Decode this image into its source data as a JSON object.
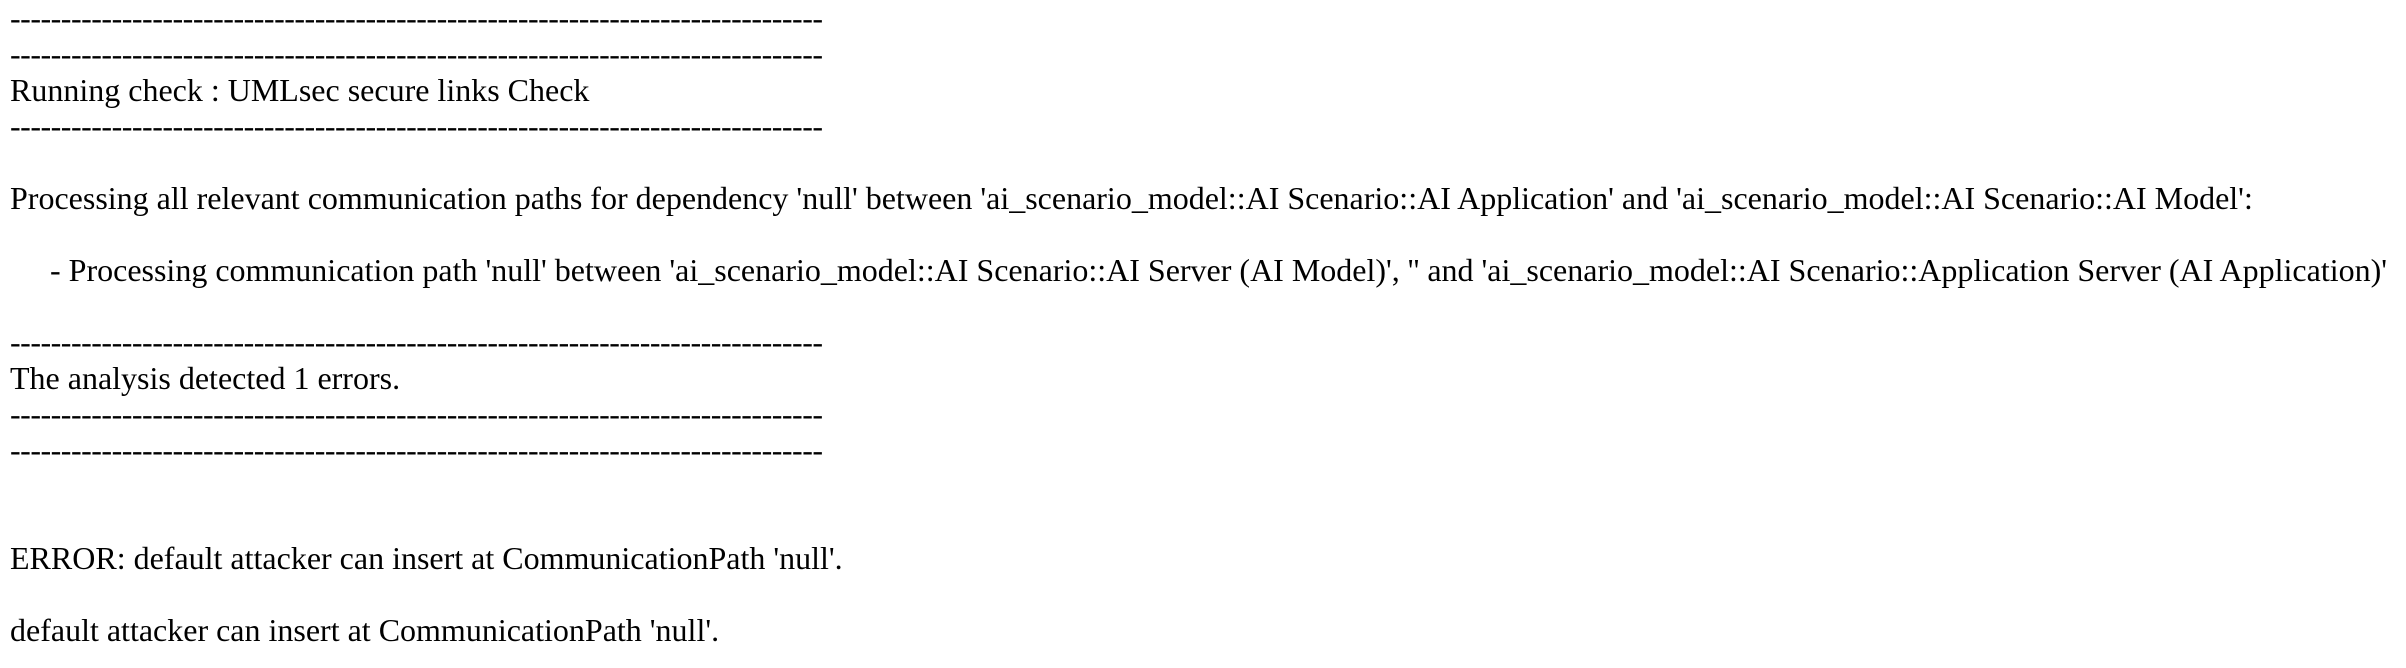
{
  "separator": "--------------------------------------------------------------------------------",
  "check": {
    "heading": "Running check : UMLsec secure links Check"
  },
  "processing": {
    "dependency_line": "Processing all relevant communication paths for dependency 'null' between 'ai_scenario_model::AI Scenario::AI Application' and 'ai_scenario_model::AI Scenario::AI Model':",
    "path_line": "- Processing communication path 'null' between 'ai_scenario_model::AI Scenario::AI Server (AI Model)', '' and 'ai_scenario_model::AI Scenario::Application Server (AI Application)'"
  },
  "summary": {
    "result": "The analysis detected 1 errors."
  },
  "errors": {
    "error_line": "ERROR: default attacker can insert at CommunicationPath 'null'.",
    "detail_line": "default attacker can insert at CommunicationPath 'null'."
  }
}
